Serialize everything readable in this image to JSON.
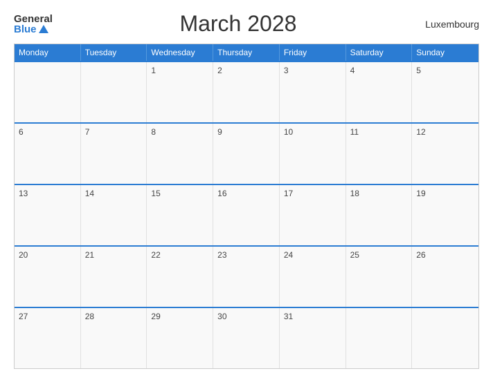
{
  "header": {
    "logo_general": "General",
    "logo_blue": "Blue",
    "title": "March 2028",
    "country": "Luxembourg"
  },
  "calendar": {
    "days": [
      "Monday",
      "Tuesday",
      "Wednesday",
      "Thursday",
      "Friday",
      "Saturday",
      "Sunday"
    ],
    "weeks": [
      [
        {
          "day": "",
          "empty": true
        },
        {
          "day": "",
          "empty": true
        },
        {
          "day": "1"
        },
        {
          "day": "2"
        },
        {
          "day": "3"
        },
        {
          "day": "4"
        },
        {
          "day": "5"
        }
      ],
      [
        {
          "day": "6"
        },
        {
          "day": "7"
        },
        {
          "day": "8"
        },
        {
          "day": "9"
        },
        {
          "day": "10"
        },
        {
          "day": "11"
        },
        {
          "day": "12"
        }
      ],
      [
        {
          "day": "13"
        },
        {
          "day": "14"
        },
        {
          "day": "15"
        },
        {
          "day": "16"
        },
        {
          "day": "17"
        },
        {
          "day": "18"
        },
        {
          "day": "19"
        }
      ],
      [
        {
          "day": "20"
        },
        {
          "day": "21"
        },
        {
          "day": "22"
        },
        {
          "day": "23"
        },
        {
          "day": "24"
        },
        {
          "day": "25"
        },
        {
          "day": "26"
        }
      ],
      [
        {
          "day": "27"
        },
        {
          "day": "28"
        },
        {
          "day": "29"
        },
        {
          "day": "30"
        },
        {
          "day": "31"
        },
        {
          "day": "",
          "empty": true
        },
        {
          "day": "",
          "empty": true
        }
      ]
    ]
  }
}
